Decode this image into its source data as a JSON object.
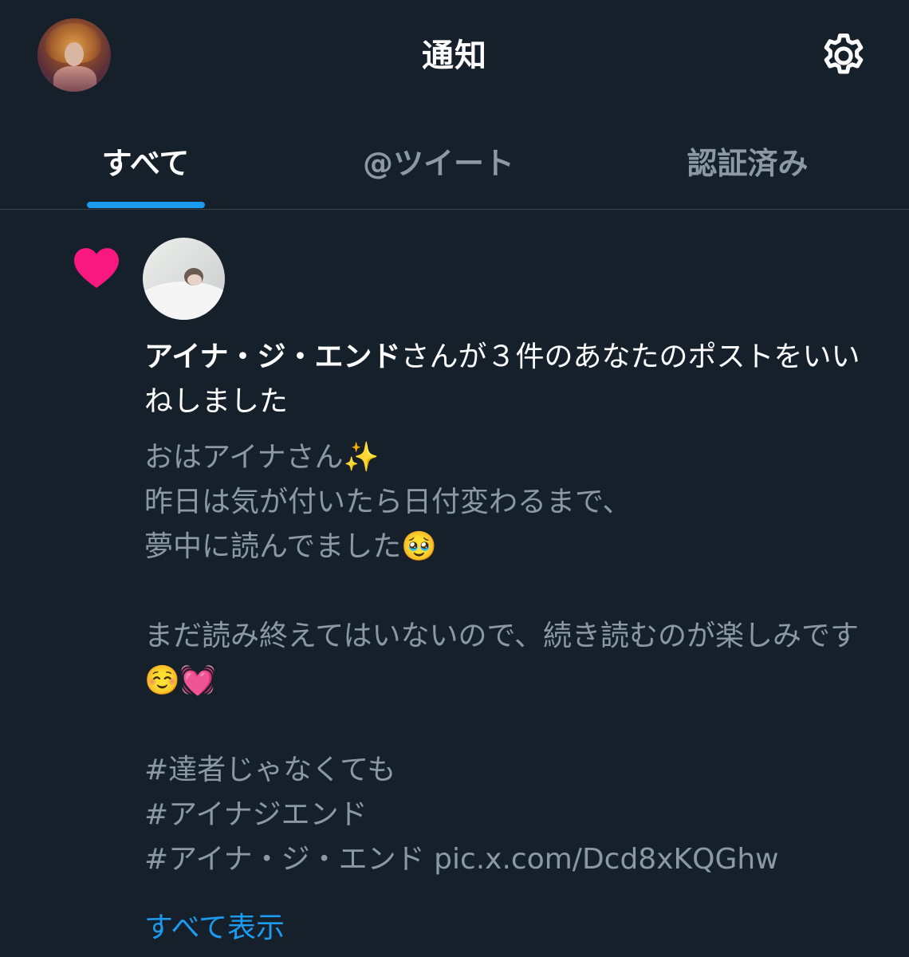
{
  "header": {
    "title": "通知",
    "avatar_icon": "user-avatar",
    "settings_icon": "gear-icon"
  },
  "tabs": [
    {
      "label": "すべて",
      "active": true
    },
    {
      "label": "@ツイート",
      "active": false
    },
    {
      "label": "認証済み",
      "active": false
    }
  ],
  "notification": {
    "type_icon": "heart-icon",
    "liker_name": "アイナ・ジ・エンド",
    "message": "さんが３件のあなたのポストをいいねしました",
    "tweet_lines": [
      "おはアイナさん✨",
      "昨日は気が付いたら日付変わるまで、",
      "夢中に読んでました🥹",
      "",
      "まだ読み終えてはいないので、続き読むのが楽しみです☺️💓",
      "",
      "#達者じゃなくても",
      "#アイナジエンド",
      "#アイナ・ジ・エンド pic.x.com/Dcd8xKQGhw"
    ],
    "show_all_label": "すべて表示"
  },
  "colors": {
    "background": "#15202b",
    "accent": "#1d9bf0",
    "heart": "#f91880",
    "muted_text": "#8b98a5",
    "divider": "#38444d"
  }
}
